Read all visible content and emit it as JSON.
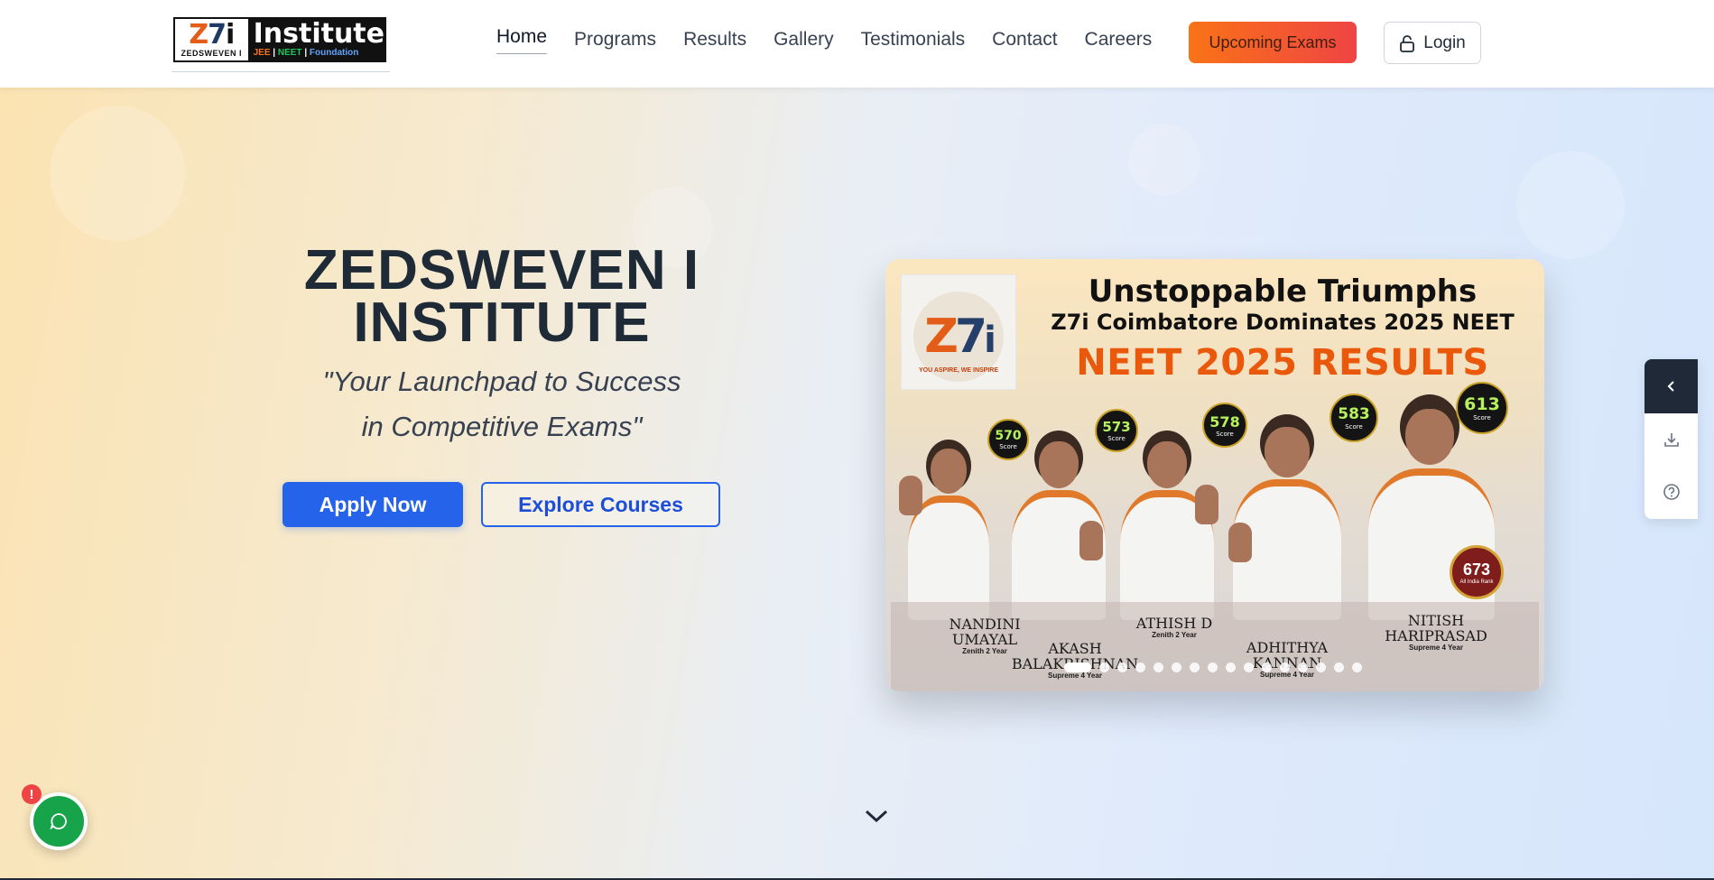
{
  "header": {
    "logo": {
      "mark": "Z7i",
      "sub": "ZEDSWEVEN I",
      "name": "Institute",
      "tags": [
        "JEE",
        "NEET",
        "Foundation"
      ]
    },
    "nav": [
      {
        "label": "Home",
        "active": true
      },
      {
        "label": "Programs"
      },
      {
        "label": "Results"
      },
      {
        "label": "Gallery"
      },
      {
        "label": "Testimonials"
      },
      {
        "label": "Contact"
      },
      {
        "label": "Careers"
      }
    ],
    "upcoming_label": "Upcoming Exams",
    "login_label": "Login"
  },
  "hero": {
    "title_line1": "ZEDSWEVEN I",
    "title_line2": "INSTITUTE",
    "tagline_line1": "\"Your Launchpad to Success",
    "tagline_line2": "in Competitive Exams\"",
    "apply_label": "Apply Now",
    "explore_label": "Explore Courses"
  },
  "slide": {
    "logo_mark": "Z7i",
    "logo_motto": "YOU ASPIRE, WE INSPIRE",
    "heading1": "Unstoppable Triumphs",
    "heading2": "Z7i Coimbatore Dominates 2025 NEET",
    "heading3": "NEET 2025 RESULTS",
    "score_label": "Score",
    "rank_value": "673",
    "rank_label": "All India Rank",
    "students": [
      {
        "name_line1": "NANDINI",
        "name_line2": "UMAYAL",
        "program": "Zenith 2 Year",
        "score": "570"
      },
      {
        "name_line1": "AKASH",
        "name_line2": "BALAKRISHNAN",
        "program": "Supreme 4 Year",
        "score": "573"
      },
      {
        "name_line1": "ATHISH D",
        "name_line2": "",
        "program": "Zenith 2 Year",
        "score": "578"
      },
      {
        "name_line1": "ADHITHYA",
        "name_line2": "KANNAN",
        "program": "Supreme 4 Year",
        "score": "583"
      },
      {
        "name_line1": "NITISH",
        "name_line2": "HARIPRASAD",
        "program": "Supreme 4 Year",
        "score": "613"
      }
    ],
    "total_slides": 16,
    "active_slide": 1
  },
  "side_panel": {
    "icons": [
      "chevron-left-icon",
      "download-icon",
      "help-icon"
    ]
  },
  "chat": {
    "alert": "!"
  },
  "colors": {
    "primary": "#2563eb",
    "accent_orange": "#f97316",
    "accent_red": "#ef4444",
    "dark": "#1f2937",
    "chat_green": "#16a34a"
  }
}
